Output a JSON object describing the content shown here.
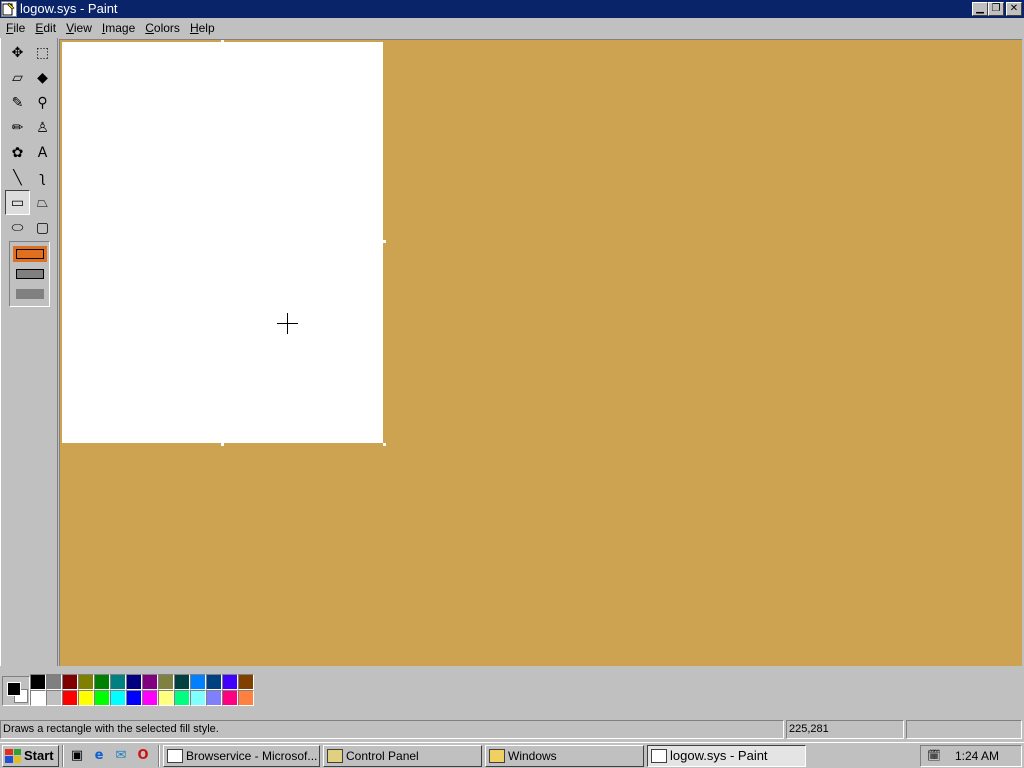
{
  "window": {
    "title": "logow.sys - Paint",
    "minimize_icon": "minimize-icon",
    "restore_icon": "restore-icon",
    "close_icon": "close-icon"
  },
  "menu": [
    "File",
    "Edit",
    "View",
    "Image",
    "Colors",
    "Help"
  ],
  "tools": [
    {
      "name": "free-form-select-icon",
      "glyph": "✥"
    },
    {
      "name": "rect-select-icon",
      "glyph": "⬚"
    },
    {
      "name": "eraser-icon",
      "glyph": "▱"
    },
    {
      "name": "fill-bucket-icon",
      "glyph": "◆"
    },
    {
      "name": "color-picker-icon",
      "glyph": "✎"
    },
    {
      "name": "magnifier-icon",
      "glyph": "⚲"
    },
    {
      "name": "pencil-icon",
      "glyph": "✏"
    },
    {
      "name": "brush-icon",
      "glyph": "♙"
    },
    {
      "name": "airbrush-icon",
      "glyph": "✿"
    },
    {
      "name": "text-icon",
      "glyph": "A"
    },
    {
      "name": "line-icon",
      "glyph": "╲"
    },
    {
      "name": "curve-icon",
      "glyph": "ʅ"
    },
    {
      "name": "rectangle-icon",
      "glyph": "▭",
      "selected": true
    },
    {
      "name": "polygon-icon",
      "glyph": "⏢"
    },
    {
      "name": "ellipse-icon",
      "glyph": "⬭"
    },
    {
      "name": "rounded-rect-icon",
      "glyph": "▢"
    }
  ],
  "fill_styles": [
    "outline",
    "outline-fill",
    "fill"
  ],
  "palette": {
    "foreground": "#000000",
    "background": "#ffffff",
    "row1": [
      "#000000",
      "#808080",
      "#800000",
      "#808000",
      "#008000",
      "#008080",
      "#000080",
      "#800080",
      "#808040",
      "#004040",
      "#0080ff",
      "#004080",
      "#4000ff",
      "#804000"
    ],
    "row2": [
      "#ffffff",
      "#c0c0c0",
      "#ff0000",
      "#ffff00",
      "#00ff00",
      "#00ffff",
      "#0000ff",
      "#ff00ff",
      "#ffff80",
      "#00ff80",
      "#80ffff",
      "#8080ff",
      "#ff0080",
      "#ff8040"
    ]
  },
  "canvas_bg": "#cda352",
  "status": {
    "help": "Draws a rectangle with the selected fill style.",
    "coords": "225,281",
    "size": ""
  },
  "taskbar": {
    "start": "Start",
    "quicklaunch": [
      "show-desktop-icon",
      "ie-icon",
      "outlook-icon",
      "opera-icon"
    ],
    "tasks": [
      {
        "label": "Browservice - Microsof...",
        "icon": "ie-page-icon"
      },
      {
        "label": "Control Panel",
        "icon": "control-panel-icon"
      },
      {
        "label": "Windows",
        "icon": "folder-icon"
      },
      {
        "label": "logow.sys - Paint",
        "icon": "paint-icon",
        "active": true
      }
    ],
    "clock": "1:24 AM"
  }
}
